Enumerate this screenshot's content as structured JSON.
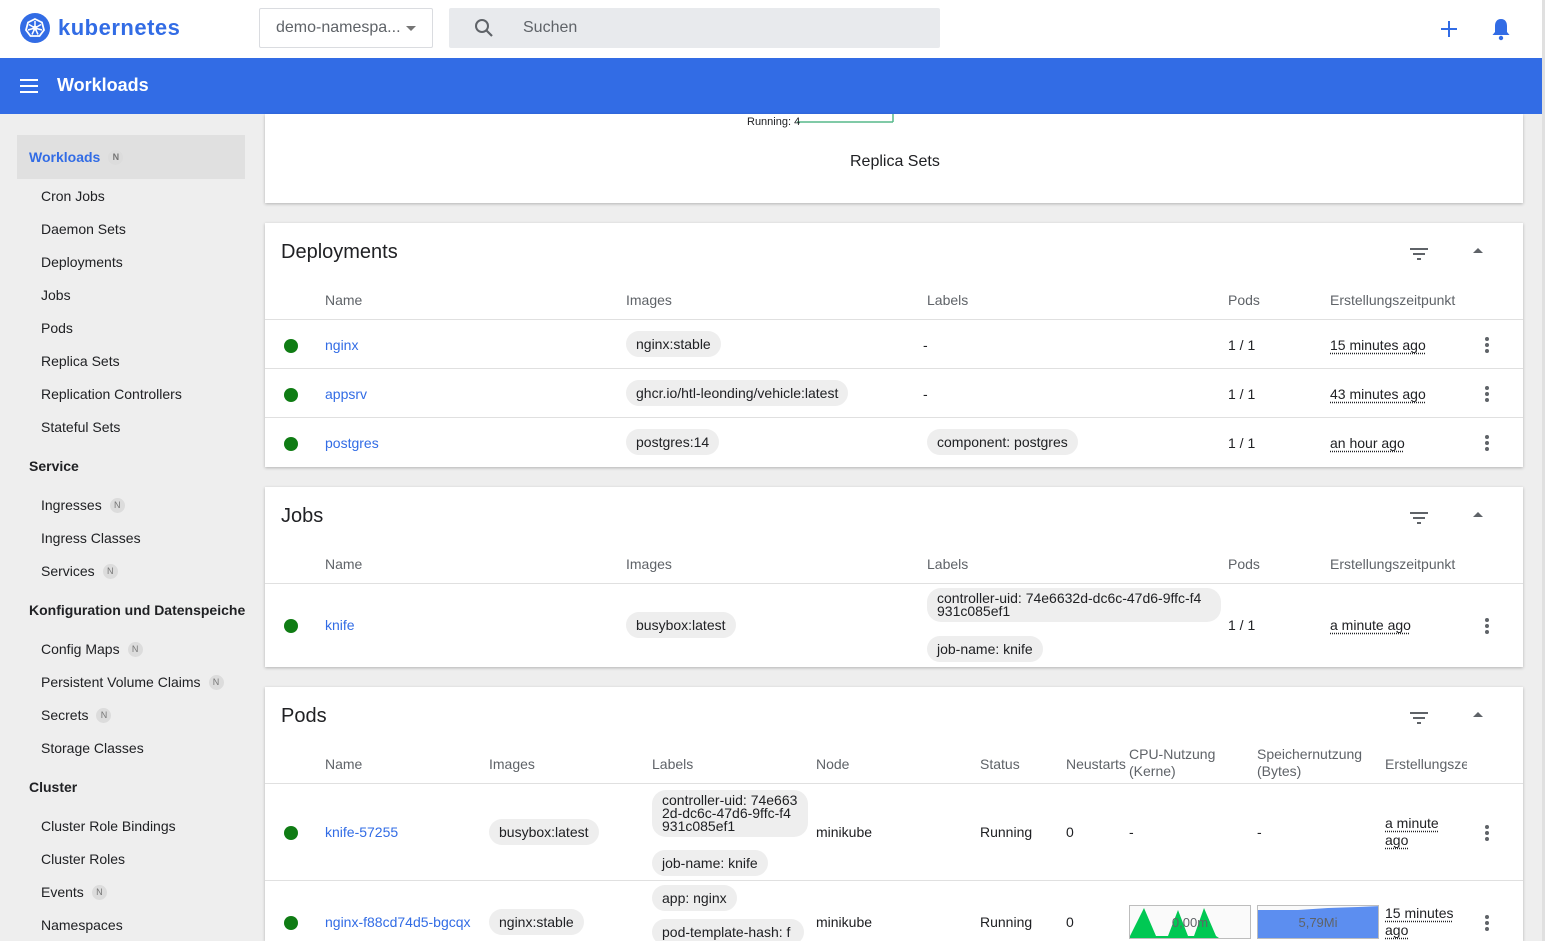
{
  "app": {
    "name": "kubernetes"
  },
  "header": {
    "namespace": "demo-namespa...",
    "search_placeholder": "Suchen"
  },
  "titlebar": {
    "title": "Workloads"
  },
  "sidebar": {
    "badge": "N",
    "workloads_label": "Workloads",
    "workloads_items": [
      "Cron Jobs",
      "Daemon Sets",
      "Deployments",
      "Jobs",
      "Pods",
      "Replica Sets",
      "Replication Controllers",
      "Stateful Sets"
    ],
    "service_label": "Service",
    "service_items": [
      "Ingresses",
      "Ingress Classes",
      "Services"
    ],
    "config_label": "Konfiguration und Datenspeicherung",
    "config_items": [
      "Config Maps",
      "Persistent Volume Claims",
      "Secrets",
      "Storage Classes"
    ],
    "cluster_label": "Cluster",
    "cluster_items": [
      "Cluster Role Bindings",
      "Cluster Roles",
      "Events",
      "Namespaces"
    ]
  },
  "replica_chart": {
    "running_label": "Running: 4",
    "caption": "Replica Sets"
  },
  "deployments": {
    "title": "Deployments",
    "columns": [
      "Name",
      "Images",
      "Labels",
      "Pods",
      "Erstellungszeitpunkt"
    ],
    "rows": [
      {
        "name": "nginx",
        "image": "nginx:stable",
        "labels": "-",
        "pods": "1 / 1",
        "created": "15 minutes ago"
      },
      {
        "name": "appsrv",
        "image": "ghcr.io/htl-leonding/vehicle:latest",
        "labels": "-",
        "pods": "1 / 1",
        "created": "43 minutes ago"
      },
      {
        "name": "postgres",
        "image": "postgres:14",
        "labels": "component: postgres",
        "pods": "1 / 1",
        "created": "an hour ago"
      }
    ]
  },
  "jobs": {
    "title": "Jobs",
    "columns": [
      "Name",
      "Images",
      "Labels",
      "Pods",
      "Erstellungszeitpunkt"
    ],
    "rows": [
      {
        "name": "knife",
        "image": "busybox:latest",
        "label1": "controller-uid: 74e6632d-dc6c-47d6-9ffc-f4 931c085ef1",
        "label2": "job-name: knife",
        "pods": "1 / 1",
        "created": "a minute ago"
      }
    ]
  },
  "pods": {
    "title": "Pods",
    "columns": [
      "Name",
      "Images",
      "Labels",
      "Node",
      "Status",
      "Neustarts",
      "CPU-Nutzung (Kerne)",
      "Speichernutzung (Bytes)",
      "Erstellungszeitpunkt"
    ],
    "rows": [
      {
        "name": "knife-57255",
        "image": "busybox:latest",
        "label1": "controller-uid: 74e663 2d-dc6c-47d6-9ffc-f4 931c085ef1",
        "label2": "job-name: knife",
        "node": "minikube",
        "status": "Running",
        "restarts": "0",
        "cpu": "-",
        "mem": "-",
        "created": "a minute ago"
      },
      {
        "name": "nginx-f88cd74d5-bgcqx",
        "image": "nginx:stable",
        "label1": "app: nginx",
        "label2": "pod-template-hash: f",
        "node": "minikube",
        "status": "Running",
        "restarts": "0",
        "cpu": "0,00m",
        "mem": "5,79Mi",
        "created": "15 minutes ago"
      }
    ]
  },
  "colors": {
    "brand": "#326ce5",
    "running": "#0f7c14",
    "cpu_spark": "#00c853",
    "mem_spark": "#326ce5"
  }
}
